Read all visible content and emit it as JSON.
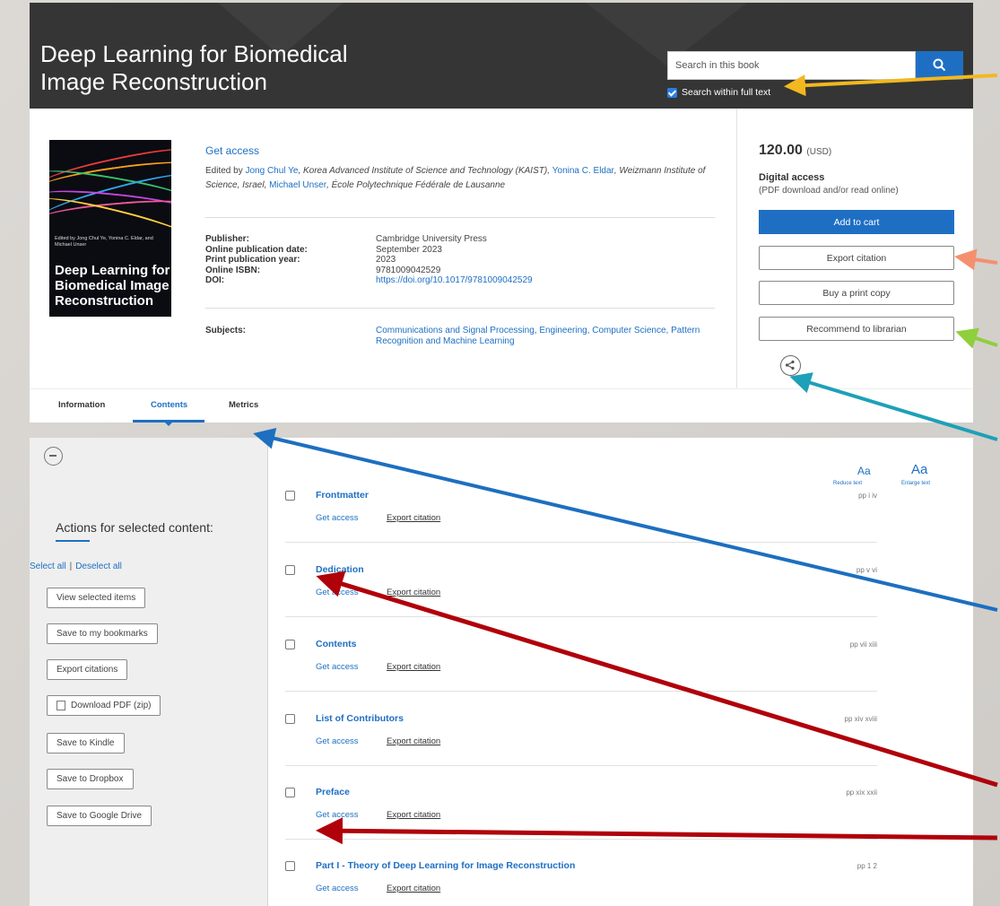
{
  "header": {
    "title_line1": "Deep Learning for Biomedical",
    "title_line2": "Image Reconstruction",
    "search_placeholder": "Search in this book",
    "search_fulltext_label": "Search within full text"
  },
  "cover": {
    "small_text": "Edited by Jong Chul Ye, Yonina C. Eldar, and Michael Unser",
    "title": "Deep Learning for Biomedical Image Reconstruction"
  },
  "book": {
    "get_access": "Get access",
    "edited_prefix": "Edited by ",
    "editor1": "Jong Chul Ye",
    "editor1_aff": ", Korea Advanced Institute of Science and Technology (KAIST), ",
    "editor2": "Yonina C. Eldar",
    "editor2_aff": ", Weizmann Institute of Science, Israel, ",
    "editor3": "Michael Unser",
    "editor3_aff": ", École Polytechnique Fédérale de Lausanne",
    "publisher_label": "Publisher:",
    "publisher": "Cambridge University Press",
    "online_date_label": "Online publication date:",
    "online_date": "September 2023",
    "print_year_label": "Print publication year:",
    "print_year": "2023",
    "isbn_label": "Online ISBN:",
    "isbn": "9781009042529",
    "doi_label": "DOI:",
    "doi": "https://doi.org/10.1017/9781009042529",
    "subjects_label": "Subjects:",
    "subjects": "Communications and Signal Processing, Engineering, Computer Science, Pattern Recognition and Machine Learning"
  },
  "purchase": {
    "price": "120.00",
    "currency": "(USD)",
    "access_title": "Digital access",
    "access_desc": "(PDF download and/or read online)",
    "add_to_cart": "Add to cart",
    "export_citation": "Export citation",
    "buy_print": "Buy a print copy",
    "recommend": "Recommend to librarian"
  },
  "tabs": [
    "Information",
    "Contents",
    "Metrics"
  ],
  "actions": {
    "title": "Actions for selected content:",
    "select_all": "Select all",
    "separator": "|",
    "deselect_all": "Deselect all",
    "buttons": [
      "View selected items",
      "Save to my bookmarks",
      "Export citations",
      "Download PDF (zip)",
      "Save to Kindle",
      "Save to Dropbox",
      "Save to Google Drive"
    ]
  },
  "text_size": {
    "small_glyph": "Aa",
    "large_glyph": "Aa",
    "reduce": "Reduce text",
    "enlarge": "Enlarge text"
  },
  "contents": [
    {
      "title": "Frontmatter",
      "pages": "pp i iv",
      "get_access": "Get access",
      "export": "Export citation"
    },
    {
      "title": "Dedication",
      "pages": "pp v vi",
      "get_access": "Get access",
      "export": "Export citation"
    },
    {
      "title": "Contents",
      "pages": "pp vii xiii",
      "get_access": "Get access",
      "export": "Export citation"
    },
    {
      "title": "List of Contributors",
      "pages": "pp xiv xviii",
      "get_access": "Get access",
      "export": "Export citation"
    },
    {
      "title": "Preface",
      "pages": "pp xix xxii",
      "get_access": "Get access",
      "export": "Export citation"
    },
    {
      "title": "Part I - Theory of Deep Learning for Image Reconstruction",
      "pages": "pp 1 2",
      "get_access": "Get access",
      "export": "Export citation"
    }
  ],
  "colors": {
    "accent": "#1e6fc4",
    "header_bg": "#353535",
    "arrow_yellow": "#f3b81f",
    "arrow_salmon": "#f4906e",
    "arrow_green": "#8fcf3c",
    "arrow_teal": "#1ea0b8",
    "arrow_blue": "#1d6fc0",
    "arrow_red": "#b0000a"
  }
}
